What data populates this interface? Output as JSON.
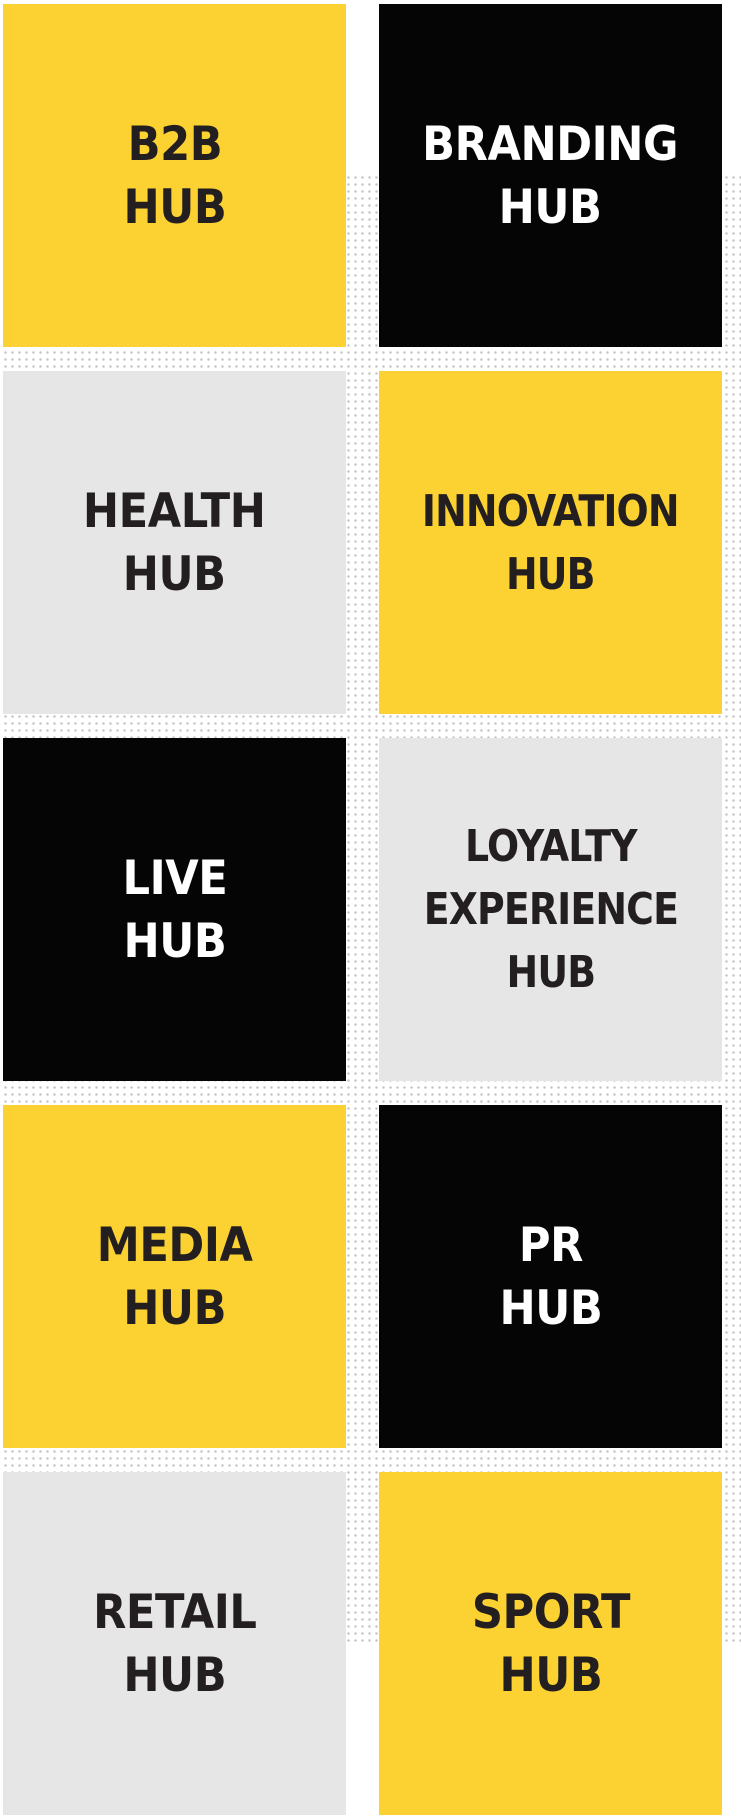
{
  "hubs": [
    {
      "label": "B2B\nHUB",
      "color": "yellow"
    },
    {
      "label": "BRANDING\nHUB",
      "color": "black"
    },
    {
      "label": "HEALTH\nHUB",
      "color": "grey"
    },
    {
      "label": "INNOVATION\nHUB",
      "color": "yellow"
    },
    {
      "label": "LIVE\nHUB",
      "color": "black"
    },
    {
      "label": "LOYALTY\nEXPERIENCE\nHUB",
      "color": "grey"
    },
    {
      "label": "MEDIA\nHUB",
      "color": "yellow"
    },
    {
      "label": "PR\nHUB",
      "color": "black"
    },
    {
      "label": "RETAIL\nHUB",
      "color": "grey"
    },
    {
      "label": "SPORT\nHUB",
      "color": "yellow"
    }
  ],
  "colors": {
    "yellow": "#fcd232",
    "black": "#050505",
    "grey": "#e6e6e6",
    "dark_text": "#231f20",
    "light_text": "#ffffff"
  }
}
